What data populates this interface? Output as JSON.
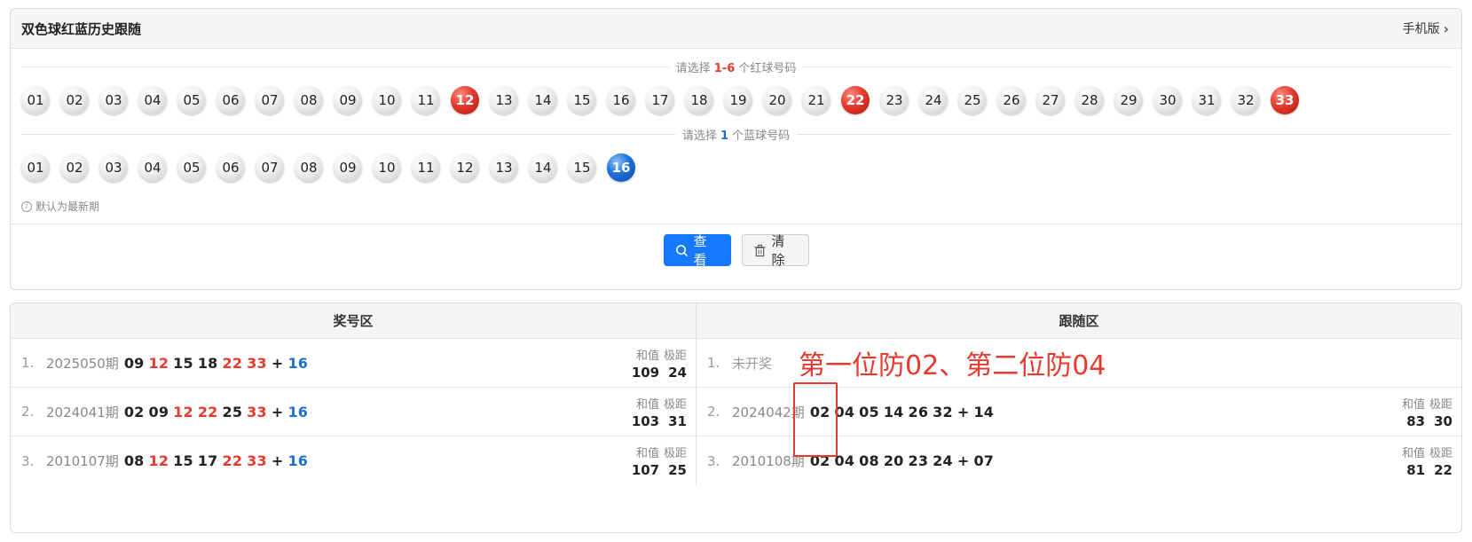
{
  "header": {
    "title": "双色球红蓝历史跟随",
    "mobile_link": "手机版",
    "chevron_icon": "chevron-right-icon"
  },
  "red_section": {
    "label_pre": "请选择 ",
    "label_range": "1-6",
    "label_post": " 个红球号码",
    "balls": [
      "01",
      "02",
      "03",
      "04",
      "05",
      "06",
      "07",
      "08",
      "09",
      "10",
      "11",
      "12",
      "13",
      "14",
      "15",
      "16",
      "17",
      "18",
      "19",
      "20",
      "21",
      "22",
      "23",
      "24",
      "25",
      "26",
      "27",
      "28",
      "29",
      "30",
      "31",
      "32",
      "33"
    ],
    "selected": [
      "12",
      "22",
      "33"
    ]
  },
  "blue_section": {
    "label_pre": "请选择 ",
    "label_count": "1",
    "label_post": " 个蓝球号码",
    "balls": [
      "01",
      "02",
      "03",
      "04",
      "05",
      "06",
      "07",
      "08",
      "09",
      "10",
      "11",
      "12",
      "13",
      "14",
      "15",
      "16"
    ],
    "selected": [
      "16"
    ]
  },
  "hint": "默认为最新期",
  "buttons": {
    "search": "查看",
    "clear": "清除"
  },
  "results": {
    "left_header": "奖号区",
    "right_header": "跟随区",
    "stat_labels": [
      "和值",
      "极距"
    ],
    "left_rows": [
      {
        "idx": "1.",
        "period": "2025050期",
        "reds": [
          [
            "09",
            "n"
          ],
          [
            "12",
            "r"
          ],
          [
            "15",
            "n"
          ],
          [
            "18",
            "n"
          ],
          [
            "22",
            "r"
          ],
          [
            "33",
            "r"
          ]
        ],
        "blue": "16",
        "sum": "109",
        "span": "24"
      },
      {
        "idx": "2.",
        "period": "2024041期",
        "reds": [
          [
            "02",
            "n"
          ],
          [
            "09",
            "n"
          ],
          [
            "12",
            "r"
          ],
          [
            "22",
            "r"
          ],
          [
            "25",
            "n"
          ],
          [
            "33",
            "r"
          ]
        ],
        "blue": "16",
        "sum": "103",
        "span": "31"
      },
      {
        "idx": "3.",
        "period": "2010107期",
        "reds": [
          [
            "08",
            "n"
          ],
          [
            "12",
            "r"
          ],
          [
            "15",
            "n"
          ],
          [
            "17",
            "n"
          ],
          [
            "22",
            "r"
          ],
          [
            "33",
            "r"
          ]
        ],
        "blue": "16",
        "sum": "107",
        "span": "25"
      }
    ],
    "right_rows": [
      {
        "idx": "1.",
        "status": "未开奖",
        "annotation": "第一位防02、第二位防04"
      },
      {
        "idx": "2.",
        "period": "2024042期",
        "reds": [
          "02",
          "04",
          "05",
          "14",
          "26",
          "32"
        ],
        "blue": "14",
        "sum": "83",
        "span": "30"
      },
      {
        "idx": "3.",
        "period": "2010108期",
        "reds": [
          "02",
          "04",
          "08",
          "20",
          "23",
          "24"
        ],
        "blue": "07",
        "sum": "81",
        "span": "22"
      }
    ]
  },
  "colors": {
    "red": "#e53a2e",
    "blue": "#1e6fd9",
    "primary": "#1677ff"
  }
}
